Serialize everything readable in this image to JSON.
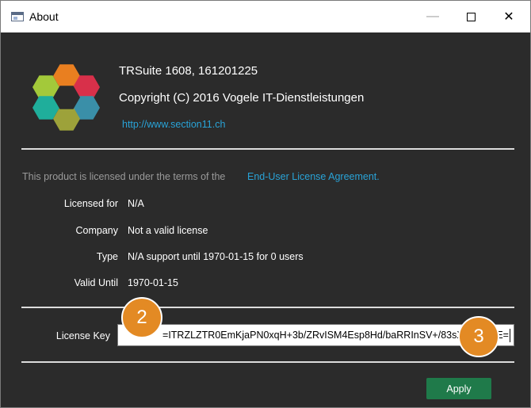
{
  "window": {
    "title": "About",
    "controls": {
      "minimize": "—",
      "maximize": "",
      "close": "✕"
    }
  },
  "app": {
    "version_line": "TRSuite 1608, 161201225",
    "copyright": "Copyright (C) 2016 Vogele IT-Dienstleistungen",
    "website": "http://www.section11.ch",
    "logo_colors": [
      "#e97f20",
      "#d8304a",
      "#a3c93a",
      "#3a8fa8",
      "#1fae9b",
      "#9da23a",
      "#2b2b2b"
    ]
  },
  "license": {
    "intro": "This product is licensed under the terms of the",
    "eula_link": "End-User License Agreement.",
    "fields": [
      {
        "label": "Licensed for",
        "value": "N/A"
      },
      {
        "label": "Company",
        "value": "Not a valid license"
      },
      {
        "label": "Type",
        "value": "N/A support until 1970-01-15 for 0 users"
      },
      {
        "label": "Valid Until",
        "value": "1970-01-15"
      }
    ],
    "key_label": "License Key",
    "key_value": "=ITRZLZTR0EmKjaPN0xqH+3b/ZRvISM4Esp8Hd/baRRInSV+/83sXmC4RkE="
  },
  "annotations": {
    "step_2": "2",
    "step_3": "3"
  },
  "actions": {
    "apply": "Apply"
  }
}
